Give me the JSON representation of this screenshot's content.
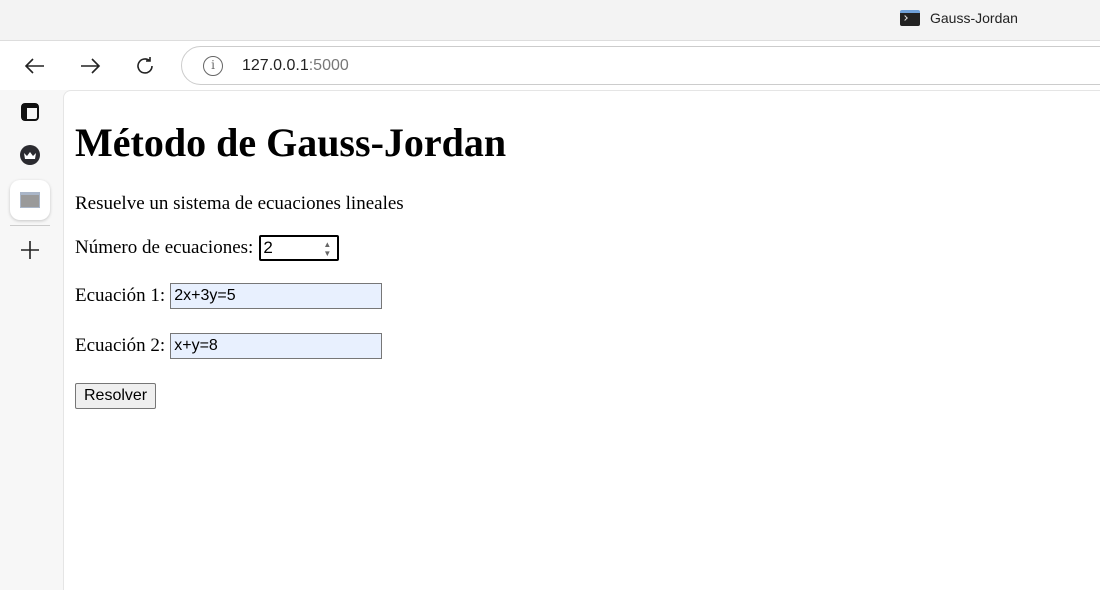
{
  "browser": {
    "tab_title": "Gauss-Jordan",
    "url_host": "127.0.0.1",
    "url_port": ":5000"
  },
  "page": {
    "title": "Método de Gauss-Jordan",
    "subtitle": "Resuelve un sistema de ecuaciones lineales",
    "num_label": "Número de ecuaciones:",
    "num_value": "2",
    "equations": [
      {
        "label": "Ecuación 1:",
        "value": "2x+3y=5"
      },
      {
        "label": "Ecuación 2:",
        "value": "x+y=8"
      }
    ],
    "solve_label": "Resolver"
  }
}
